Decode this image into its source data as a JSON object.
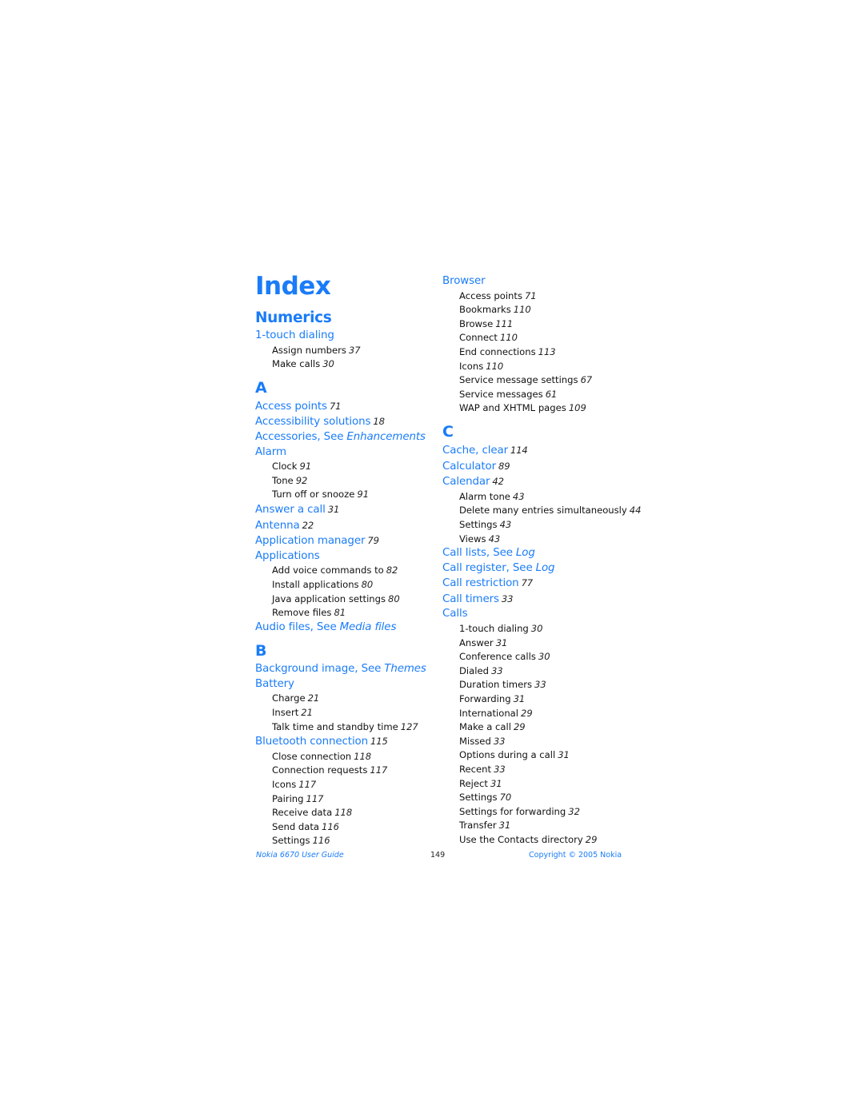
{
  "page": {
    "title": "Index",
    "footer": {
      "left": "Nokia 6670 User Guide",
      "page_number": "149",
      "right": "Copyright © 2005 Nokia"
    }
  },
  "left_column": [
    {
      "type": "section",
      "text": "Numerics"
    },
    {
      "type": "entry",
      "text": "1-touch dialing",
      "page": ""
    },
    {
      "type": "sub",
      "text": "Assign numbers",
      "page": "37"
    },
    {
      "type": "sub",
      "text": "Make calls",
      "page": "30"
    },
    {
      "type": "letter",
      "text": "A"
    },
    {
      "type": "entry",
      "text": "Access points",
      "page": "71"
    },
    {
      "type": "entry",
      "text": "Accessibility solutions",
      "page": "18"
    },
    {
      "type": "entry",
      "text": "Accessories, See",
      "see": "Enhancements"
    },
    {
      "type": "entry",
      "text": "Alarm",
      "page": ""
    },
    {
      "type": "sub",
      "text": "Clock",
      "page": "91"
    },
    {
      "type": "sub",
      "text": "Tone",
      "page": "92"
    },
    {
      "type": "sub",
      "text": "Turn off or snooze",
      "page": "91"
    },
    {
      "type": "entry",
      "text": "Answer a call",
      "page": "31"
    },
    {
      "type": "entry",
      "text": "Antenna",
      "page": "22"
    },
    {
      "type": "entry",
      "text": "Application manager",
      "page": "79"
    },
    {
      "type": "entry",
      "text": "Applications",
      "page": ""
    },
    {
      "type": "sub",
      "text": "Add voice commands to",
      "page": "82"
    },
    {
      "type": "sub",
      "text": "Install applications",
      "page": "80"
    },
    {
      "type": "sub",
      "text": "Java application settings",
      "page": "80"
    },
    {
      "type": "sub",
      "text": "Remove files",
      "page": "81"
    },
    {
      "type": "entry",
      "text": "Audio files, See",
      "see": "Media files"
    },
    {
      "type": "letter",
      "text": "B"
    },
    {
      "type": "entry",
      "text": "Background image, See",
      "see": "Themes"
    },
    {
      "type": "entry",
      "text": "Battery",
      "page": ""
    },
    {
      "type": "sub",
      "text": "Charge",
      "page": "21"
    },
    {
      "type": "sub",
      "text": "Insert",
      "page": "21"
    },
    {
      "type": "sub",
      "text": "Talk time and standby time",
      "page": "127"
    },
    {
      "type": "entry",
      "text": "Bluetooth connection",
      "page": "115"
    },
    {
      "type": "sub",
      "text": "Close connection",
      "page": "118"
    },
    {
      "type": "sub",
      "text": "Connection requests",
      "page": "117"
    },
    {
      "type": "sub",
      "text": "Icons",
      "page": "117"
    },
    {
      "type": "sub",
      "text": "Pairing",
      "page": "117"
    },
    {
      "type": "sub",
      "text": "Receive data",
      "page": "118"
    },
    {
      "type": "sub",
      "text": "Send data",
      "page": "116"
    },
    {
      "type": "sub",
      "text": "Settings",
      "page": "116"
    }
  ],
  "right_column": [
    {
      "type": "entry",
      "text": "Browser",
      "page": ""
    },
    {
      "type": "sub",
      "text": "Access points",
      "page": "71"
    },
    {
      "type": "sub",
      "text": "Bookmarks",
      "page": "110"
    },
    {
      "type": "sub",
      "text": "Browse",
      "page": "111"
    },
    {
      "type": "sub",
      "text": "Connect",
      "page": "110"
    },
    {
      "type": "sub",
      "text": "End connections",
      "page": "113"
    },
    {
      "type": "sub",
      "text": "Icons",
      "page": "110"
    },
    {
      "type": "sub",
      "text": "Service message settings",
      "page": "67"
    },
    {
      "type": "sub",
      "text": "Service messages",
      "page": "61"
    },
    {
      "type": "sub",
      "text": "WAP and XHTML pages",
      "page": "109"
    },
    {
      "type": "letter",
      "text": "C"
    },
    {
      "type": "entry",
      "text": "Cache, clear",
      "page": "114"
    },
    {
      "type": "entry",
      "text": "Calculator",
      "page": "89"
    },
    {
      "type": "entry",
      "text": "Calendar",
      "page": "42"
    },
    {
      "type": "sub",
      "text": "Alarm tone",
      "page": "43"
    },
    {
      "type": "sub",
      "text": "Delete many entries simultaneously",
      "page": "44"
    },
    {
      "type": "sub",
      "text": "Settings",
      "page": "43"
    },
    {
      "type": "sub",
      "text": "Views",
      "page": "43"
    },
    {
      "type": "entry",
      "text": "Call lists, See",
      "see": "Log"
    },
    {
      "type": "entry",
      "text": "Call register, See",
      "see": "Log"
    },
    {
      "type": "entry",
      "text": "Call restriction",
      "page": "77"
    },
    {
      "type": "entry",
      "text": "Call timers",
      "page": "33"
    },
    {
      "type": "entry",
      "text": "Calls",
      "page": ""
    },
    {
      "type": "sub",
      "text": "1-touch dialing",
      "page": "30"
    },
    {
      "type": "sub",
      "text": "Answer",
      "page": "31"
    },
    {
      "type": "sub",
      "text": "Conference calls",
      "page": "30"
    },
    {
      "type": "sub",
      "text": "Dialed",
      "page": "33"
    },
    {
      "type": "sub",
      "text": "Duration timers",
      "page": "33"
    },
    {
      "type": "sub",
      "text": "Forwarding",
      "page": "31"
    },
    {
      "type": "sub",
      "text": "International",
      "page": "29"
    },
    {
      "type": "sub",
      "text": "Make a call",
      "page": "29"
    },
    {
      "type": "sub",
      "text": "Missed",
      "page": "33"
    },
    {
      "type": "sub",
      "text": "Options during a call",
      "page": "31"
    },
    {
      "type": "sub",
      "text": "Recent",
      "page": "33"
    },
    {
      "type": "sub",
      "text": "Reject",
      "page": "31"
    },
    {
      "type": "sub",
      "text": "Settings",
      "page": "70"
    },
    {
      "type": "sub",
      "text": "Settings for forwarding",
      "page": "32"
    },
    {
      "type": "sub",
      "text": "Transfer",
      "page": "31"
    },
    {
      "type": "sub",
      "text": "Use the Contacts directory",
      "page": "29"
    }
  ]
}
